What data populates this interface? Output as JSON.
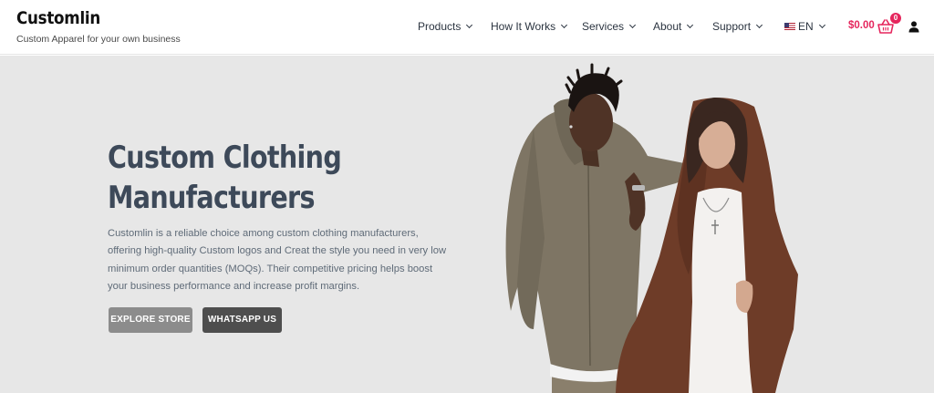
{
  "brand": {
    "name": "Customlin",
    "tagline": "Custom Apparel for your own business"
  },
  "nav": {
    "items": [
      {
        "label": "Products"
      },
      {
        "label": "How It Works"
      },
      {
        "label": "Services"
      },
      {
        "label": "About"
      },
      {
        "label": "Support"
      }
    ],
    "language": "EN"
  },
  "cart": {
    "total": "$0.00",
    "count": "0"
  },
  "hero": {
    "title": "Custom Clothing Manufacturers",
    "description": "Customlin is a reliable choice among custom clothing manufacturers, offering high-quality Custom logos and Creat the style you need in very low minimum order quantities (MOQs). Their competitive pricing helps boost your business performance and increase profit margins.",
    "primary_button": "EXPLORE STORE",
    "secondary_button": "WHATSAPP US"
  },
  "colors": {
    "accent": "#e5265d",
    "hero_background": "#e7e7e7",
    "title_color": "#3d4959",
    "explore_button": "#8c8c8c",
    "whatsapp_button": "#4e4e4e"
  }
}
